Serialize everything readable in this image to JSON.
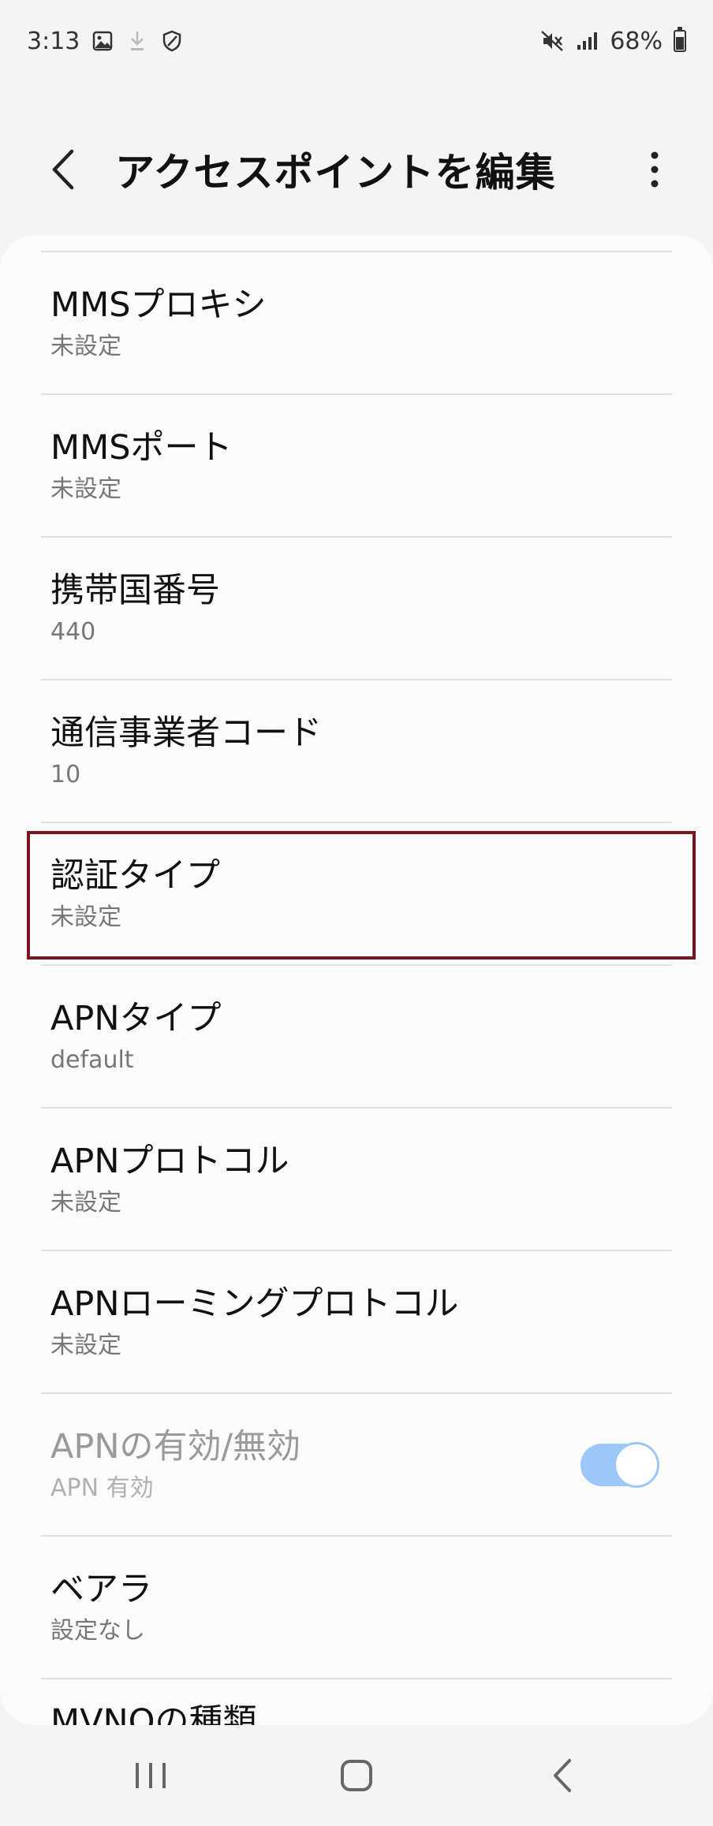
{
  "status_bar": {
    "time": "3:13",
    "battery": "68%",
    "battery_level": 0.68
  },
  "header": {
    "title": "アクセスポイントを編集"
  },
  "items": [
    {
      "title": "MMSプロキシ",
      "subtitle": "未設定"
    },
    {
      "title": "MMSポート",
      "subtitle": "未設定"
    },
    {
      "title": "携帯国番号",
      "subtitle": "440"
    },
    {
      "title": "通信事業者コード",
      "subtitle": "10"
    },
    {
      "title": "認証タイプ",
      "subtitle": "未設定"
    },
    {
      "title": "APNタイプ",
      "subtitle": "default"
    },
    {
      "title": "APNプロトコル",
      "subtitle": "未設定"
    },
    {
      "title": "APNローミングプロトコル",
      "subtitle": "未設定"
    },
    {
      "title": "APNの有効/無効",
      "subtitle": "APN 有効",
      "toggle_on": true
    },
    {
      "title": "ベアラ",
      "subtitle": "設定なし"
    },
    {
      "title": "MVNOの種類"
    }
  ],
  "colors": {
    "highlight_border": "#7a1420",
    "toggle_on": "#9cc7f6"
  },
  "icons": {
    "back": "chevron-left-icon",
    "more": "more-vertical-icon",
    "nav_recents": "recents-icon",
    "nav_home": "home-icon",
    "nav_back": "back-icon"
  }
}
